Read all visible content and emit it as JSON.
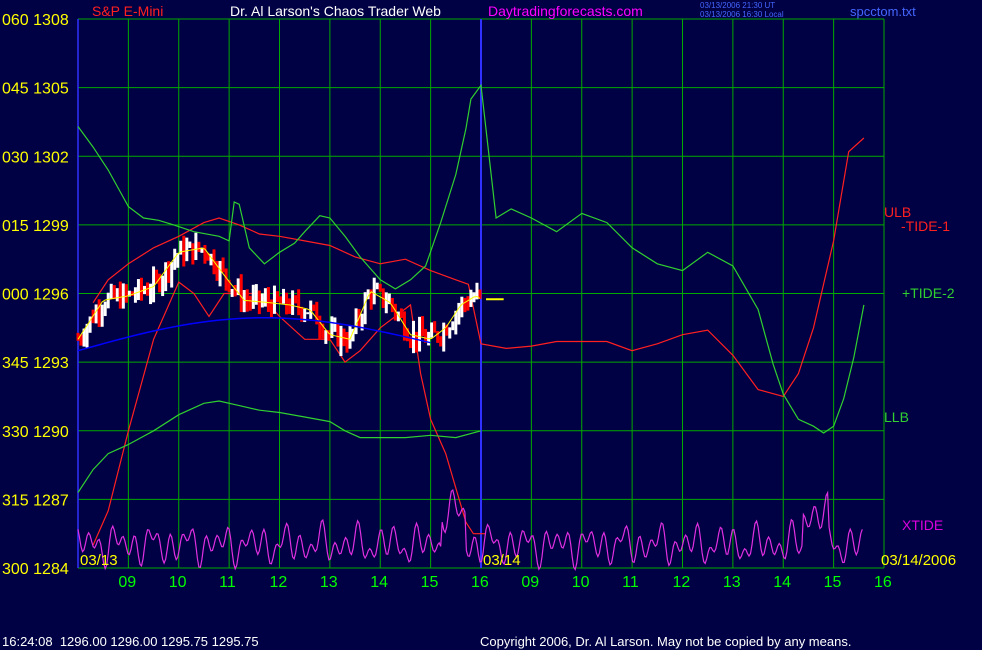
{
  "header": {
    "symbol": "S&P E-Mini",
    "title": "Dr. Al Larson's Chaos Trader Web",
    "site": "Daytradingforecasts.com",
    "stamp_ut": "03/13/2006 21:30 UT",
    "stamp_local": "03/13/2006 16:30 Local",
    "file": "spcctom.txt"
  },
  "footer": {
    "quote": "16:24:08  1296.00 1296.00 1295.75 1295.75",
    "copyright": "Copyright 2006, Dr. Al Larson. May not be copied by any means."
  },
  "colors": {
    "background": "#000044",
    "grid": "#00aa00",
    "price_up": "#ffffff",
    "price_down": "#ff0000",
    "moving_avg": "#ffff00",
    "slow_avg": "#0000ff",
    "ulb_tide1": "#ff2020",
    "llb_tide2": "#30d030",
    "xtide": "#e030e0",
    "marker": "#3030ff",
    "label_yellow": "#ffff00",
    "label_green": "#00ff00",
    "label_purple": "#dd00dd"
  },
  "chart_data": {
    "type": "line",
    "ylim": [
      1284,
      1308
    ],
    "y_ticks": [
      1284,
      1287,
      1290,
      1293,
      1296,
      1299,
      1302,
      1305,
      1308
    ],
    "y_tick_labels": [
      "300 1284",
      "315 1287",
      "330 1290",
      "345 1293",
      "000 1296",
      "015 1299",
      "030 1302",
      "045 1305",
      "060 1308"
    ],
    "x_hours": [
      9,
      10,
      11,
      12,
      13,
      14,
      15,
      16,
      9,
      10,
      11,
      12,
      13,
      14,
      15,
      16
    ],
    "x_tick_labels": [
      "09",
      "10",
      "11",
      "12",
      "13",
      "14",
      "15",
      "16",
      "09",
      "10",
      "11",
      "12",
      "13",
      "14",
      "15",
      "16"
    ],
    "date_labels": [
      "03/13",
      "03/14",
      "03/14/2006"
    ],
    "series_labels": [
      "ULB",
      "-TIDE-1",
      "+TIDE-2",
      "LLB",
      "XTIDE"
    ],
    "last_price": 1295.75,
    "series": [
      {
        "name": "ULB",
        "color": "#ff2020",
        "x": [
          8.3,
          8.6,
          9.0,
          9.5,
          10.0,
          10.5,
          10.8,
          11.2,
          11.6,
          12.0,
          12.5,
          13.0,
          13.5,
          14.0,
          14.5,
          15.0,
          15.5,
          15.75,
          16.0,
          16.5,
          17.0,
          17.5,
          18.0,
          18.5,
          19.0,
          19.5,
          20.0,
          20.5,
          21.0,
          21.5,
          22.0,
          22.3,
          22.6,
          23.0,
          23.3,
          23.6
        ],
        "y": [
          1295.6,
          1296.6,
          1297.3,
          1298.0,
          1298.5,
          1299.1,
          1299.3,
          1299.0,
          1298.6,
          1298.5,
          1298.3,
          1298.1,
          1297.6,
          1297.3,
          1297.5,
          1297.0,
          1296.6,
          1296.4,
          1293.8,
          1293.6,
          1293.7,
          1293.9,
          1293.9,
          1293.9,
          1293.5,
          1293.8,
          1294.2,
          1294.4,
          1293.3,
          1291.8,
          1291.5,
          1292.5,
          1294.5,
          1298.3,
          1302.2,
          1302.8
        ]
      },
      {
        "name": "TIDE-1",
        "color": "#ff2020",
        "x": [
          8.3,
          8.6,
          9.0,
          9.5,
          10.0,
          10.3,
          10.6,
          10.9,
          11.2,
          11.6,
          12.0,
          12.5,
          13.0,
          13.3,
          13.6,
          14.0,
          14.3,
          14.6,
          14.8,
          15.0,
          15.3,
          15.5,
          15.7,
          15.85,
          16.0,
          16.1
        ],
        "y": [
          1285.0,
          1286.5,
          1290.0,
          1294.0,
          1296.5,
          1296.0,
          1295.0,
          1296.0,
          1296.0,
          1296.0,
          1295.0,
          1294.0,
          1294.0,
          1293.0,
          1293.5,
          1294.5,
          1295.0,
          1295.5,
          1292.5,
          1290.5,
          1289.0,
          1287.5,
          1286.0,
          1285.5,
          1285.5,
          1285.5
        ]
      },
      {
        "name": "TIDE-2",
        "color": "#30d030",
        "x": [
          8.0,
          8.3,
          8.6,
          9.0,
          9.3,
          9.6,
          9.9,
          10.3,
          10.8,
          11.0,
          11.1,
          11.2,
          11.4,
          11.7,
          12.0,
          12.3,
          12.5,
          12.8,
          13.0,
          13.3,
          13.6,
          14.0,
          14.3,
          14.6,
          14.9,
          15.2,
          15.5,
          15.7,
          15.8,
          16.0,
          16.3,
          16.6,
          17.0,
          17.5,
          18.0,
          18.5,
          19.0,
          19.5,
          20.0,
          20.5,
          21.0,
          21.5,
          21.8,
          22.0,
          22.3,
          22.6,
          22.8,
          23.0,
          23.2,
          23.4,
          23.6
        ],
        "y": [
          1303.3,
          1302.4,
          1301.4,
          1299.8,
          1299.3,
          1299.2,
          1299.0,
          1298.7,
          1298.5,
          1298.3,
          1300.0,
          1299.9,
          1298.0,
          1297.3,
          1297.8,
          1298.2,
          1298.7,
          1299.4,
          1299.3,
          1298.5,
          1297.6,
          1296.6,
          1296.2,
          1296.6,
          1297.2,
          1299.1,
          1301.2,
          1303.2,
          1304.5,
          1305.1,
          1299.3,
          1299.7,
          1299.3,
          1298.7,
          1299.5,
          1299.1,
          1298.0,
          1297.3,
          1297.0,
          1297.8,
          1297.2,
          1295.3,
          1292.9,
          1291.6,
          1290.5,
          1290.2,
          1289.9,
          1290.2,
          1291.4,
          1293.2,
          1295.5
        ]
      },
      {
        "name": "LLB",
        "color": "#30d030",
        "x": [
          8.0,
          8.3,
          8.6,
          9.0,
          9.5,
          10.0,
          10.5,
          10.8,
          11.2,
          11.6,
          12.0,
          12.5,
          13.0,
          13.3,
          13.6,
          14.0,
          14.5,
          15.0,
          15.5,
          16.0
        ],
        "y": [
          1287.3,
          1288.3,
          1289.0,
          1289.4,
          1290.0,
          1290.7,
          1291.2,
          1291.3,
          1291.1,
          1290.9,
          1290.8,
          1290.6,
          1290.4,
          1290.0,
          1289.7,
          1289.7,
          1289.7,
          1289.8,
          1289.7,
          1290.0
        ]
      },
      {
        "name": "XTIDE",
        "color": "#e030e0",
        "wave": true
      }
    ]
  }
}
